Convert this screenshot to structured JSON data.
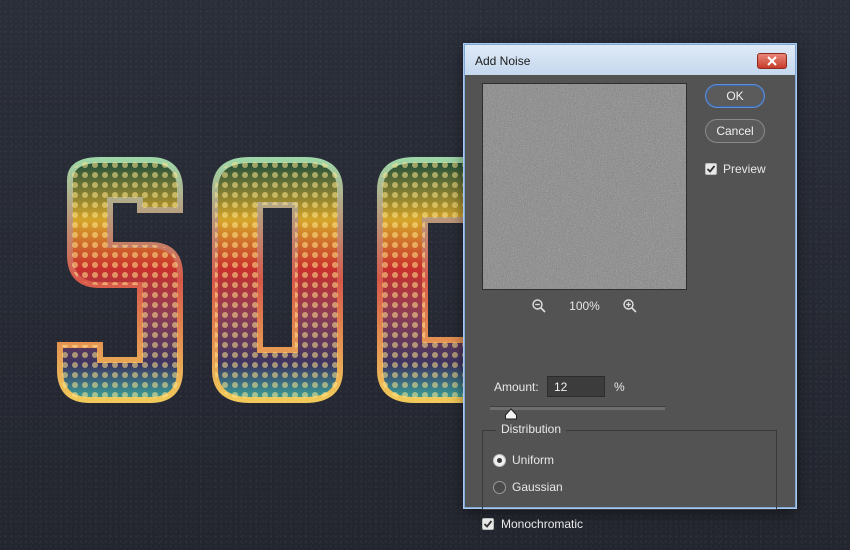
{
  "dialog": {
    "title": "Add Noise",
    "ok_label": "OK",
    "cancel_label": "Cancel",
    "preview_label": "Preview",
    "preview_checked": true,
    "zoom_level": "100%",
    "amount_label": "Amount:",
    "amount_value": "12",
    "amount_unit": "%",
    "amount_slider_fraction": 0.12,
    "distribution": {
      "title": "Distribution",
      "options": [
        "Uniform",
        "Gaussian"
      ],
      "selected": "Uniform"
    },
    "monochromatic_label": "Monochromatic",
    "monochromatic_checked": true
  },
  "icons": {
    "close": "close-icon",
    "zoom_out": "zoom-out-icon",
    "zoom_in": "zoom-in-icon",
    "check": "checkmark-icon"
  },
  "colors": {
    "dialog_bg": "#535353",
    "title_bar": "#cddcef",
    "close_red": "#c73c2a",
    "ok_border": "#5f8fd6",
    "canvas_bg": "#262a35"
  }
}
